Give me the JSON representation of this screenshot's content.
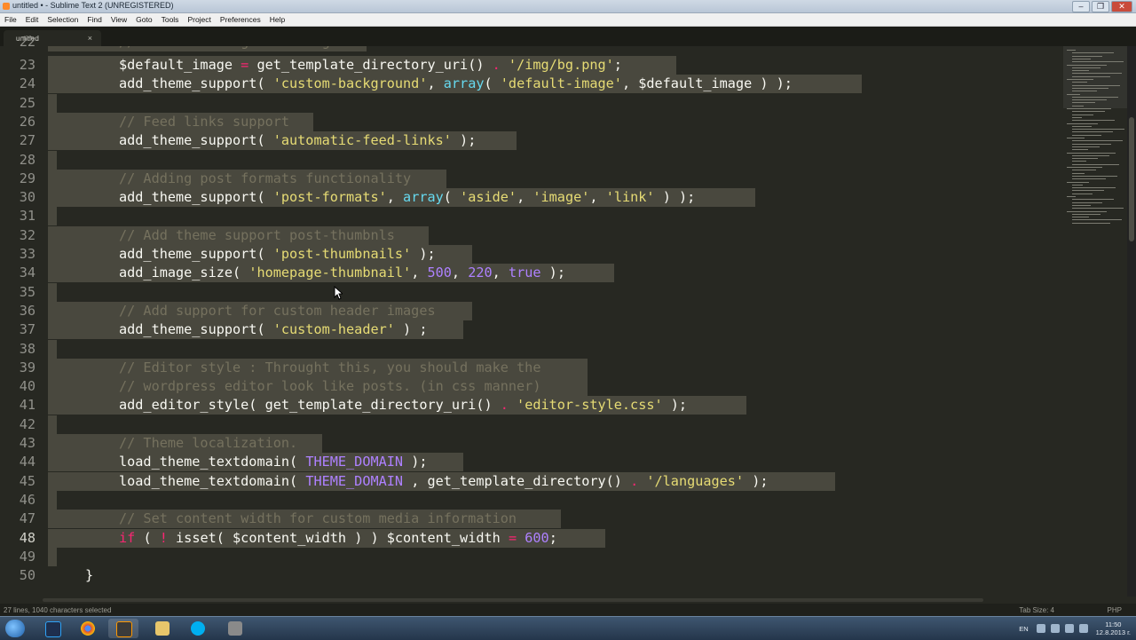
{
  "window": {
    "title": "untitled • - Sublime Text 2 (UNREGISTERED)",
    "buttons": [
      "–",
      "❐",
      "✕"
    ]
  },
  "menu": [
    "File",
    "Edit",
    "Selection",
    "Find",
    "View",
    "Goto",
    "Tools",
    "Project",
    "Preferences",
    "Help"
  ],
  "tab": {
    "label": "untitled",
    "close": "×"
  },
  "status": {
    "left": "27 lines, 1040 characters selected",
    "tab_size": "Tab Size: 4",
    "syntax": "PHP"
  },
  "taskbar": {
    "lang": "EN",
    "time": "11:50",
    "date": "12.8.2013 г."
  },
  "colors": {
    "background": "#272822",
    "selection": "#49483e",
    "comment": "#75715e",
    "string": "#e6db74",
    "keyword": "#f92672",
    "number": "#ae81ff"
  },
  "code": {
    "first_line": 22,
    "partial_top": "// Default background image",
    "lines": [
      {
        "n": "23",
        "t": [
          [
            "var",
            "$default_image"
          ],
          [
            "op",
            " = "
          ],
          [
            "fn",
            "get_template_directory_uri()"
          ],
          [
            "op",
            " . "
          ],
          [
            "str",
            "'/img/bg.png'"
          ],
          [
            "fn",
            ";"
          ]
        ]
      },
      {
        "n": "24",
        "t": [
          [
            "fn",
            "add_theme_support( "
          ],
          [
            "str",
            "'custom-background'"
          ],
          [
            "fn",
            ", "
          ],
          [
            "builtin",
            "array"
          ],
          [
            "fn",
            "( "
          ],
          [
            "str",
            "'default-image'"
          ],
          [
            "fn",
            ", $default_image ) );"
          ]
        ]
      },
      {
        "n": "25",
        "t": []
      },
      {
        "n": "26",
        "t": [
          [
            "cmt",
            "// Feed links support"
          ]
        ]
      },
      {
        "n": "27",
        "t": [
          [
            "fn",
            "add_theme_support( "
          ],
          [
            "str",
            "'automatic-feed-links'"
          ],
          [
            "fn",
            " );"
          ]
        ]
      },
      {
        "n": "28",
        "t": []
      },
      {
        "n": "29",
        "t": [
          [
            "cmt",
            "// Adding post formats functionality"
          ]
        ]
      },
      {
        "n": "30",
        "t": [
          [
            "fn",
            "add_theme_support( "
          ],
          [
            "str",
            "'post-formats'"
          ],
          [
            "fn",
            ", "
          ],
          [
            "builtin",
            "array"
          ],
          [
            "fn",
            "( "
          ],
          [
            "str",
            "'aside'"
          ],
          [
            "fn",
            ", "
          ],
          [
            "str",
            "'image'"
          ],
          [
            "fn",
            ", "
          ],
          [
            "str",
            "'link'"
          ],
          [
            "fn",
            " ) );"
          ]
        ]
      },
      {
        "n": "31",
        "t": []
      },
      {
        "n": "32",
        "t": [
          [
            "cmt",
            "// Add theme support post-thumbnls"
          ]
        ]
      },
      {
        "n": "33",
        "t": [
          [
            "fn",
            "add_theme_support( "
          ],
          [
            "str",
            "'post-thumbnails'"
          ],
          [
            "fn",
            " );"
          ]
        ]
      },
      {
        "n": "34",
        "t": [
          [
            "fn",
            "add_image_size( "
          ],
          [
            "str",
            "'homepage-thumbnail'"
          ],
          [
            "fn",
            ", "
          ],
          [
            "num",
            "500"
          ],
          [
            "fn",
            ", "
          ],
          [
            "num",
            "220"
          ],
          [
            "fn",
            ", "
          ],
          [
            "const",
            "true"
          ],
          [
            "fn",
            " );"
          ]
        ]
      },
      {
        "n": "35",
        "t": []
      },
      {
        "n": "36",
        "t": [
          [
            "cmt",
            "// Add support for custom header images"
          ]
        ]
      },
      {
        "n": "37",
        "t": [
          [
            "fn",
            "add_theme_support( "
          ],
          [
            "str",
            "'custom-header'"
          ],
          [
            "fn",
            " ) ;"
          ]
        ]
      },
      {
        "n": "38",
        "t": []
      },
      {
        "n": "39",
        "t": [
          [
            "cmt",
            "// Editor style : Throught this, you should make the"
          ]
        ]
      },
      {
        "n": "40",
        "t": [
          [
            "cmt",
            "// wordpress editor look like posts. (in css manner)"
          ]
        ]
      },
      {
        "n": "41",
        "t": [
          [
            "fn",
            "add_editor_style( get_template_directory_uri()"
          ],
          [
            "op",
            " . "
          ],
          [
            "str",
            "'editor-style.css'"
          ],
          [
            "fn",
            " );"
          ]
        ]
      },
      {
        "n": "42",
        "t": []
      },
      {
        "n": "43",
        "t": [
          [
            "cmt",
            "// Theme localization."
          ]
        ]
      },
      {
        "n": "44",
        "t": [
          [
            "fn",
            "load_theme_textdomain( "
          ],
          [
            "const",
            "THEME_DOMAIN"
          ],
          [
            "fn",
            " );"
          ]
        ]
      },
      {
        "n": "45",
        "t": [
          [
            "fn",
            "load_theme_textdomain( "
          ],
          [
            "const",
            "THEME_DOMAIN"
          ],
          [
            "fn",
            " , get_template_directory()"
          ],
          [
            "op",
            " . "
          ],
          [
            "str",
            "'/languages'"
          ],
          [
            "fn",
            " );"
          ]
        ]
      },
      {
        "n": "46",
        "t": []
      },
      {
        "n": "47",
        "t": [
          [
            "cmt",
            "// Set content width for custom media information"
          ]
        ]
      },
      {
        "n": "48",
        "t": [
          [
            "kw",
            "if"
          ],
          [
            "fn",
            " ( "
          ],
          [
            "op",
            "!"
          ],
          [
            "fn",
            " isset( $content_width ) ) $content_width "
          ],
          [
            "op",
            "="
          ],
          [
            "fn",
            " "
          ],
          [
            "num",
            "600"
          ],
          [
            "fn",
            ";"
          ]
        ]
      },
      {
        "n": "49",
        "t": []
      },
      {
        "n": "50",
        "t": [
          [
            "fn",
            "}"
          ]
        ]
      }
    ]
  }
}
